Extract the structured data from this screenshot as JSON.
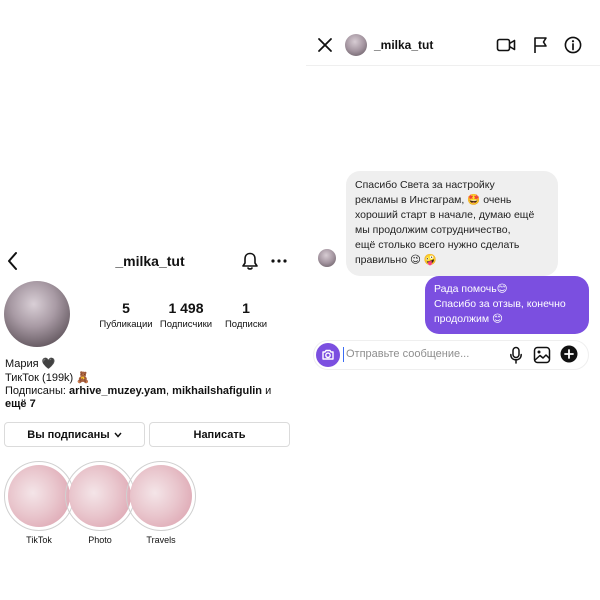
{
  "profile": {
    "username": "_milka_tut",
    "stats": [
      {
        "value": "5",
        "label": "Публикации"
      },
      {
        "value": "1 498",
        "label": "Подписчики"
      },
      {
        "value": "1",
        "label": "Подписки"
      }
    ],
    "bio": {
      "name": "Мария 🖤",
      "line2": "ТикТок (199k) 🧸",
      "followed_prefix": "Подписаны: ",
      "followed_user1": "arhive_muzey.yam",
      "followed_sep": ", ",
      "followed_user2": "mikhailshafigulin",
      "followed_and": " и ",
      "followed_more": "ещё 7"
    },
    "buttons": {
      "following_label": "Вы подписаны",
      "message_label": "Написать"
    },
    "highlights": [
      {
        "label": "TikTok"
      },
      {
        "label": "Photo"
      },
      {
        "label": "Travels"
      }
    ]
  },
  "chat": {
    "header": {
      "username": "_milka_tut"
    },
    "messages": [
      {
        "direction": "incoming",
        "lines": [
          "Спасибо Света за настройку",
          "рекламы в Инстаграм, 🤩 очень",
          "хороший старт в начале, думаю ещё",
          "мы продолжим сотрудничество,",
          "ещё столько всего нужно сделать",
          "правильно 😉 🤪"
        ]
      },
      {
        "direction": "outgoing",
        "lines": [
          "Рада помочь😊",
          "Спасибо за отзыв, конечно",
          "продолжим 😊"
        ]
      }
    ],
    "composer": {
      "placeholder": "Отправьте сообщение..."
    }
  },
  "colors": {
    "accent_purple": "#7b4fe0",
    "incoming_bubble": "#efefef",
    "border": "#dbdbdb"
  },
  "icons": [
    "back-arrow-icon",
    "bell-icon",
    "more-icon",
    "chevron-down-icon",
    "close-icon",
    "video-camera-icon",
    "flag-icon",
    "info-icon",
    "camera-icon",
    "microphone-icon",
    "gallery-icon",
    "plus-icon"
  ]
}
